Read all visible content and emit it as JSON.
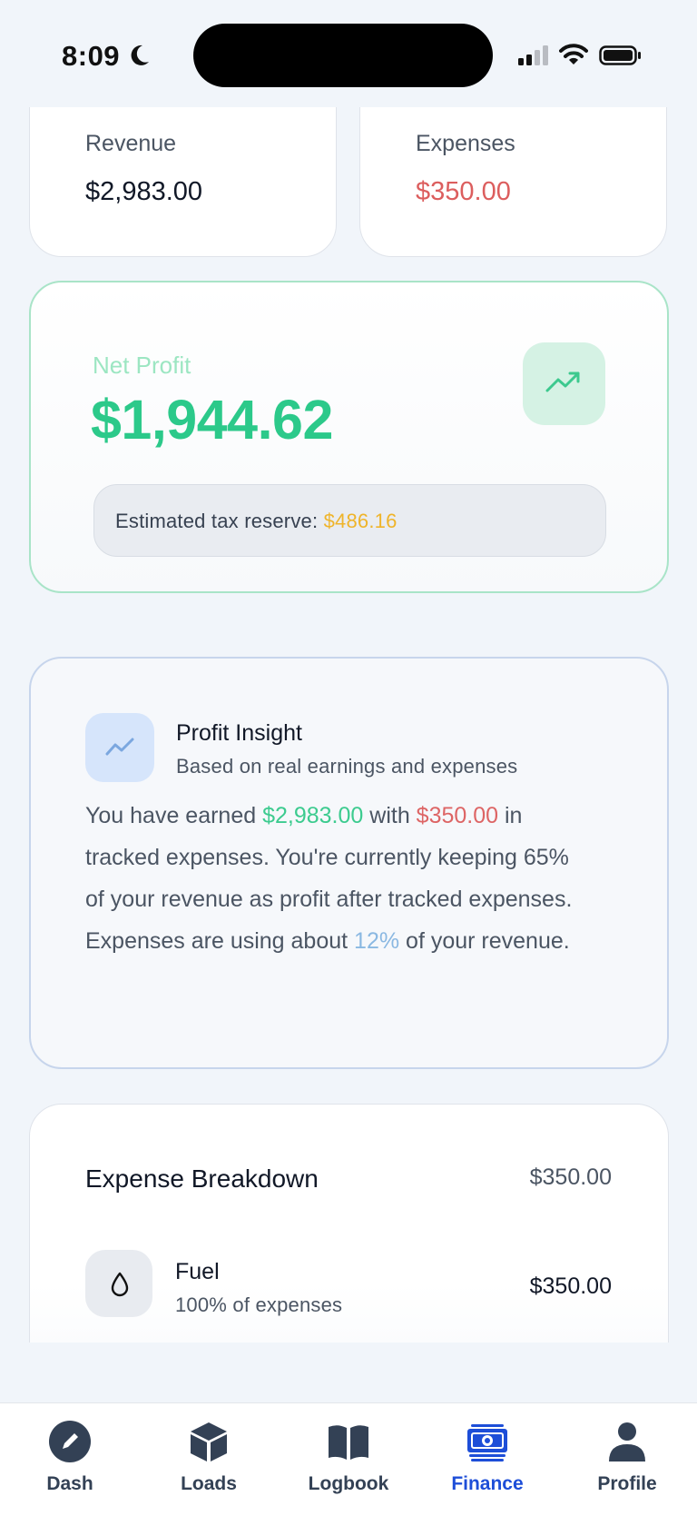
{
  "status_bar": {
    "time": "8:09"
  },
  "stats": {
    "revenue": {
      "label": "Revenue",
      "value": "$2,983.00"
    },
    "expenses": {
      "label": "Expenses",
      "value": "$350.00"
    }
  },
  "net_profit": {
    "label": "Net Profit",
    "value": "$1,944.62",
    "tax_label": "Estimated tax reserve: ",
    "tax_amount": "$486.16"
  },
  "insight": {
    "title": "Profit Insight",
    "subtitle": "Based on real earnings and expenses",
    "text_1": "You have earned ",
    "earned": "$2,983.00",
    "text_2": " with ",
    "expenses": "$350.00",
    "text_3": " in tracked expenses. You're currently keeping 65% of your revenue as profit after tracked expenses. Expenses are using about ",
    "expense_pct": "12%",
    "text_4": " of your revenue."
  },
  "expense_breakdown": {
    "title": "Expense Breakdown",
    "total": "$350.00",
    "items": [
      {
        "name": "Fuel",
        "share": "100% of expenses",
        "amount": "$350.00",
        "icon": "droplet-icon"
      }
    ]
  },
  "tabs": [
    {
      "label": "Dash",
      "icon": "pencil-icon"
    },
    {
      "label": "Loads",
      "icon": "box-icon"
    },
    {
      "label": "Logbook",
      "icon": "book-icon"
    },
    {
      "label": "Finance",
      "icon": "money-icon",
      "active": true
    },
    {
      "label": "Profile",
      "icon": "person-icon"
    }
  ],
  "colors": {
    "accent": "#1d4ed8",
    "profit_green": "#2cc98a",
    "expense_red": "#dc5e5e",
    "tax_yellow": "#efb42a"
  }
}
